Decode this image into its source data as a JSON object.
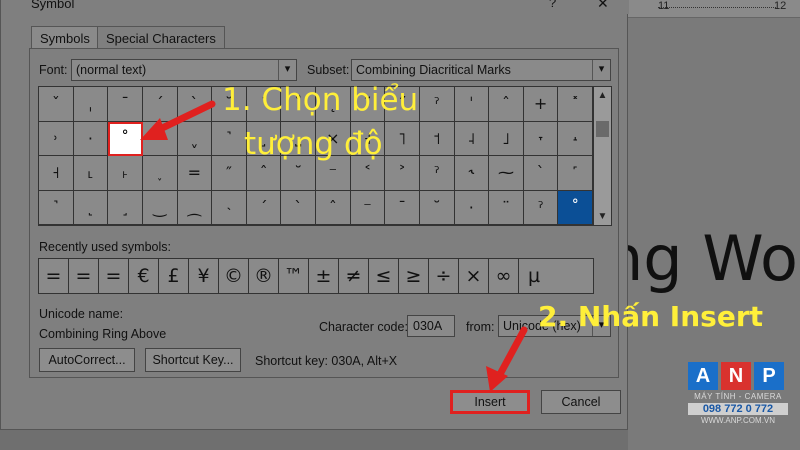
{
  "window": {
    "title": "Symbol",
    "help": "?",
    "close": "✕"
  },
  "ruler": {
    "tick_left": "11",
    "tick_right": "12"
  },
  "document": {
    "visible_text": "ng Wor"
  },
  "tabs": [
    {
      "label": "Symbols",
      "active": true
    },
    {
      "label": "Special Characters",
      "active": false
    }
  ],
  "font": {
    "label": "Font:",
    "value": "(normal text)"
  },
  "subset": {
    "label": "Subset:",
    "value": "Combining Diacritical Marks"
  },
  "symbol_grid": {
    "rows": [
      [
        "ˇ",
        "ˌ",
        "ˉ",
        "ˊ",
        "ˋ",
        "˘",
        "˙",
        "˚",
        "˛",
        "˜",
        "˝",
        "ˀ",
        "ˈ",
        "ˆ",
        "+",
        "˟"
      ],
      [
        "˒",
        "·",
        "˚",
        "˓",
        "ˬ",
        "˺",
        "˼",
        "˽",
        "×",
        "˧",
        "˥",
        "˦",
        "˨",
        "˩",
        "˕",
        "˔"
      ],
      [
        "˧",
        "˪",
        "˫",
        "˯",
        "=",
        "″",
        "ˆ",
        "˘",
        "⁻",
        "˂",
        "˃",
        "ˀ",
        "˞",
        "⁓",
        "ˋ",
        "˹"
      ],
      [
        "˺",
        "˻",
        "˼",
        "‿",
        "⁔",
        "˴",
        "ˊ",
        "ˋ",
        "ˆ",
        "⁻",
        "ˉ",
        "˘",
        "·",
        "¨",
        "ˀ",
        "˚"
      ]
    ]
  },
  "recently_used": {
    "label": "Recently used symbols:",
    "symbols": [
      "=",
      "=",
      "=",
      "€",
      "£",
      "¥",
      "©",
      "®",
      "™",
      "±",
      "≠",
      "≤",
      "≥",
      "÷",
      "×",
      "∞",
      "µ"
    ]
  },
  "unicode_name": {
    "label": "Unicode name:",
    "value": "Combining Ring Above"
  },
  "character_code": {
    "label": "Character code:",
    "value": "030A"
  },
  "from": {
    "label": "from:",
    "value": "Unicode (hex)"
  },
  "buttons": {
    "autocorrect": "AutoCorrect...",
    "shortcut_key": "Shortcut Key...",
    "insert": "Insert",
    "cancel": "Cancel"
  },
  "shortcut_info": "Shortcut key: 030A, Alt+X",
  "annotations": {
    "step1_line1": "1. Chọn biểu",
    "step1_line2": "tượng độ",
    "step2": "2. Nhấn Insert"
  },
  "logo": {
    "letters": [
      "A",
      "N",
      "P"
    ],
    "letter_colors": [
      "#1a6fc9",
      "#d9322e",
      "#1a6fc9"
    ],
    "tagline": "MÁY TÍNH - CAMERA",
    "phone": "098 772 0 772",
    "website": "WWW.ANP.COM.VN"
  },
  "colors": {
    "annotation": "#ffef3a",
    "highlight_red": "#e0211f",
    "selected_blue": "#0b4f96"
  }
}
